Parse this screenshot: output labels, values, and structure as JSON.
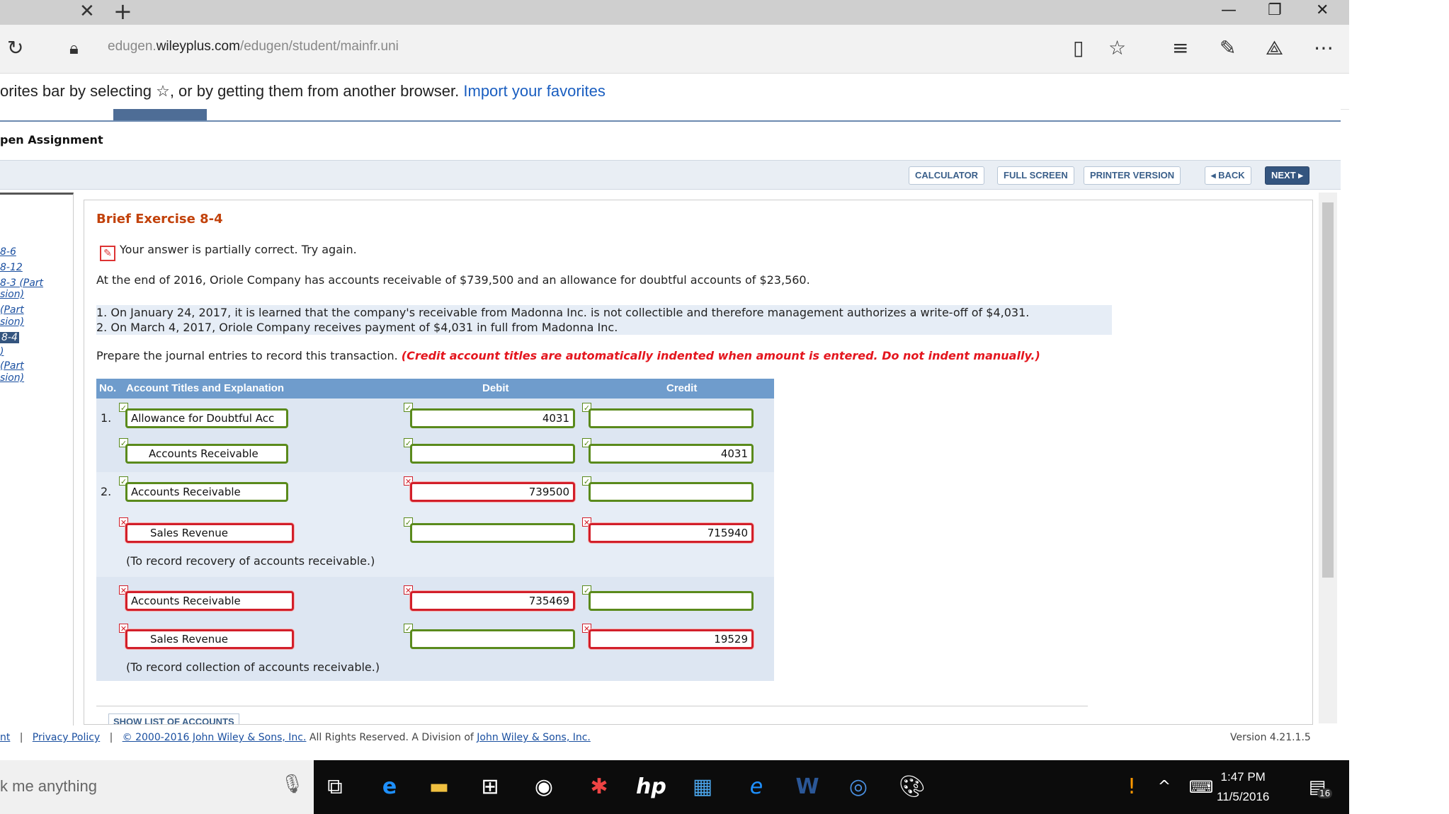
{
  "browser": {
    "url_prefix": "edugen.",
    "url_domain": "wileyplus.com",
    "url_path": "/edugen/student/mainfr.uni",
    "favorites_message": "orites bar by selecting ☆, or by getting them from another browser.",
    "favorites_link": "Import your favorites"
  },
  "page": {
    "assignment_title": "pen Assignment",
    "toolbar": {
      "calculator": "CALCULATOR",
      "full_screen": "FULL SCREEN",
      "printer": "PRINTER VERSION",
      "back": "◂ BACK",
      "next": "NEXT ▸"
    },
    "leftnav": [
      {
        "label": "8-6",
        "selected": false
      },
      {
        "label": "8-12",
        "selected": false
      },
      {
        "label": "8-3 (Part",
        "selected": false
      },
      {
        "label": "sion)",
        "selected": false
      },
      {
        "label": "(Part",
        "selected": false
      },
      {
        "label": "sion)",
        "selected": false
      },
      {
        "label": "8-4",
        "selected": true
      },
      {
        "label": ")",
        "selected": false
      },
      {
        "label": "(Part",
        "selected": false
      },
      {
        "label": "sion)",
        "selected": false
      }
    ],
    "exercise_title": "Brief Exercise 8-4",
    "status": "Your answer is partially correct.  Try again.",
    "problem": "At the end of 2016, Oriole Company has accounts receivable of $739,500 and an allowance for doubtful accounts of $23,560.",
    "items": [
      "1.  On January 24, 2017, it is learned that the company's receivable from Madonna Inc. is not collectible and therefore management authorizes a write-off of $4,031.",
      "2.  On March 4, 2017, Oriole Company receives payment of $4,031 in full from Madonna Inc."
    ],
    "instruction": "Prepare the journal entries to record this transaction. ",
    "instruction_note": "(Credit account titles are automatically indented when amount is entered. Do not indent manually.)",
    "journal": {
      "headers": {
        "no": "No.",
        "account": "Account Titles and Explanation",
        "debit": "Debit",
        "credit": "Credit"
      },
      "entries": [
        {
          "no": "1.",
          "account": "Allowance for Doubtful Acc",
          "debit": "4031",
          "credit": "",
          "acc_ok": true,
          "deb_ok": true,
          "cred_ok": true
        },
        {
          "no": "",
          "account": "Accounts Receivable",
          "debit": "",
          "credit": "4031",
          "acc_ok": true,
          "deb_ok": true,
          "cred_ok": true
        },
        {
          "no": "2.",
          "account": "Accounts Receivable",
          "debit": "739500",
          "credit": "",
          "acc_ok": true,
          "deb_ok": false,
          "cred_ok": true
        },
        {
          "no": "",
          "account": "Sales Revenue",
          "debit": "",
          "credit": "715940",
          "acc_ok": false,
          "deb_ok": true,
          "cred_ok": false
        },
        {
          "no": "",
          "account": "Accounts Receivable",
          "debit": "735469",
          "credit": "",
          "acc_ok": false,
          "deb_ok": false,
          "cred_ok": true
        },
        {
          "no": "",
          "account": "Sales Revenue",
          "debit": "",
          "credit": "19529",
          "acc_ok": false,
          "deb_ok": true,
          "cred_ok": false
        }
      ],
      "note1": "(To record recovery of accounts receivable.)",
      "note2": "(To record collection of accounts receivable.)"
    },
    "show_list": "SHOW LIST OF ACCOUNTS",
    "footer": {
      "left_fragment": "nt",
      "privacy": "Privacy Policy",
      "copyright_link": "© 2000-2016 John Wiley & Sons, Inc.",
      "rights": " All Rights Reserved. A Division of ",
      "wiley_link": "John Wiley & Sons, Inc.",
      "version": "Version 4.21.1.5"
    }
  },
  "taskbar": {
    "search_placeholder": "k me anything",
    "time": "1:47 PM",
    "date": "11/5/2016",
    "notification_count": "16"
  }
}
